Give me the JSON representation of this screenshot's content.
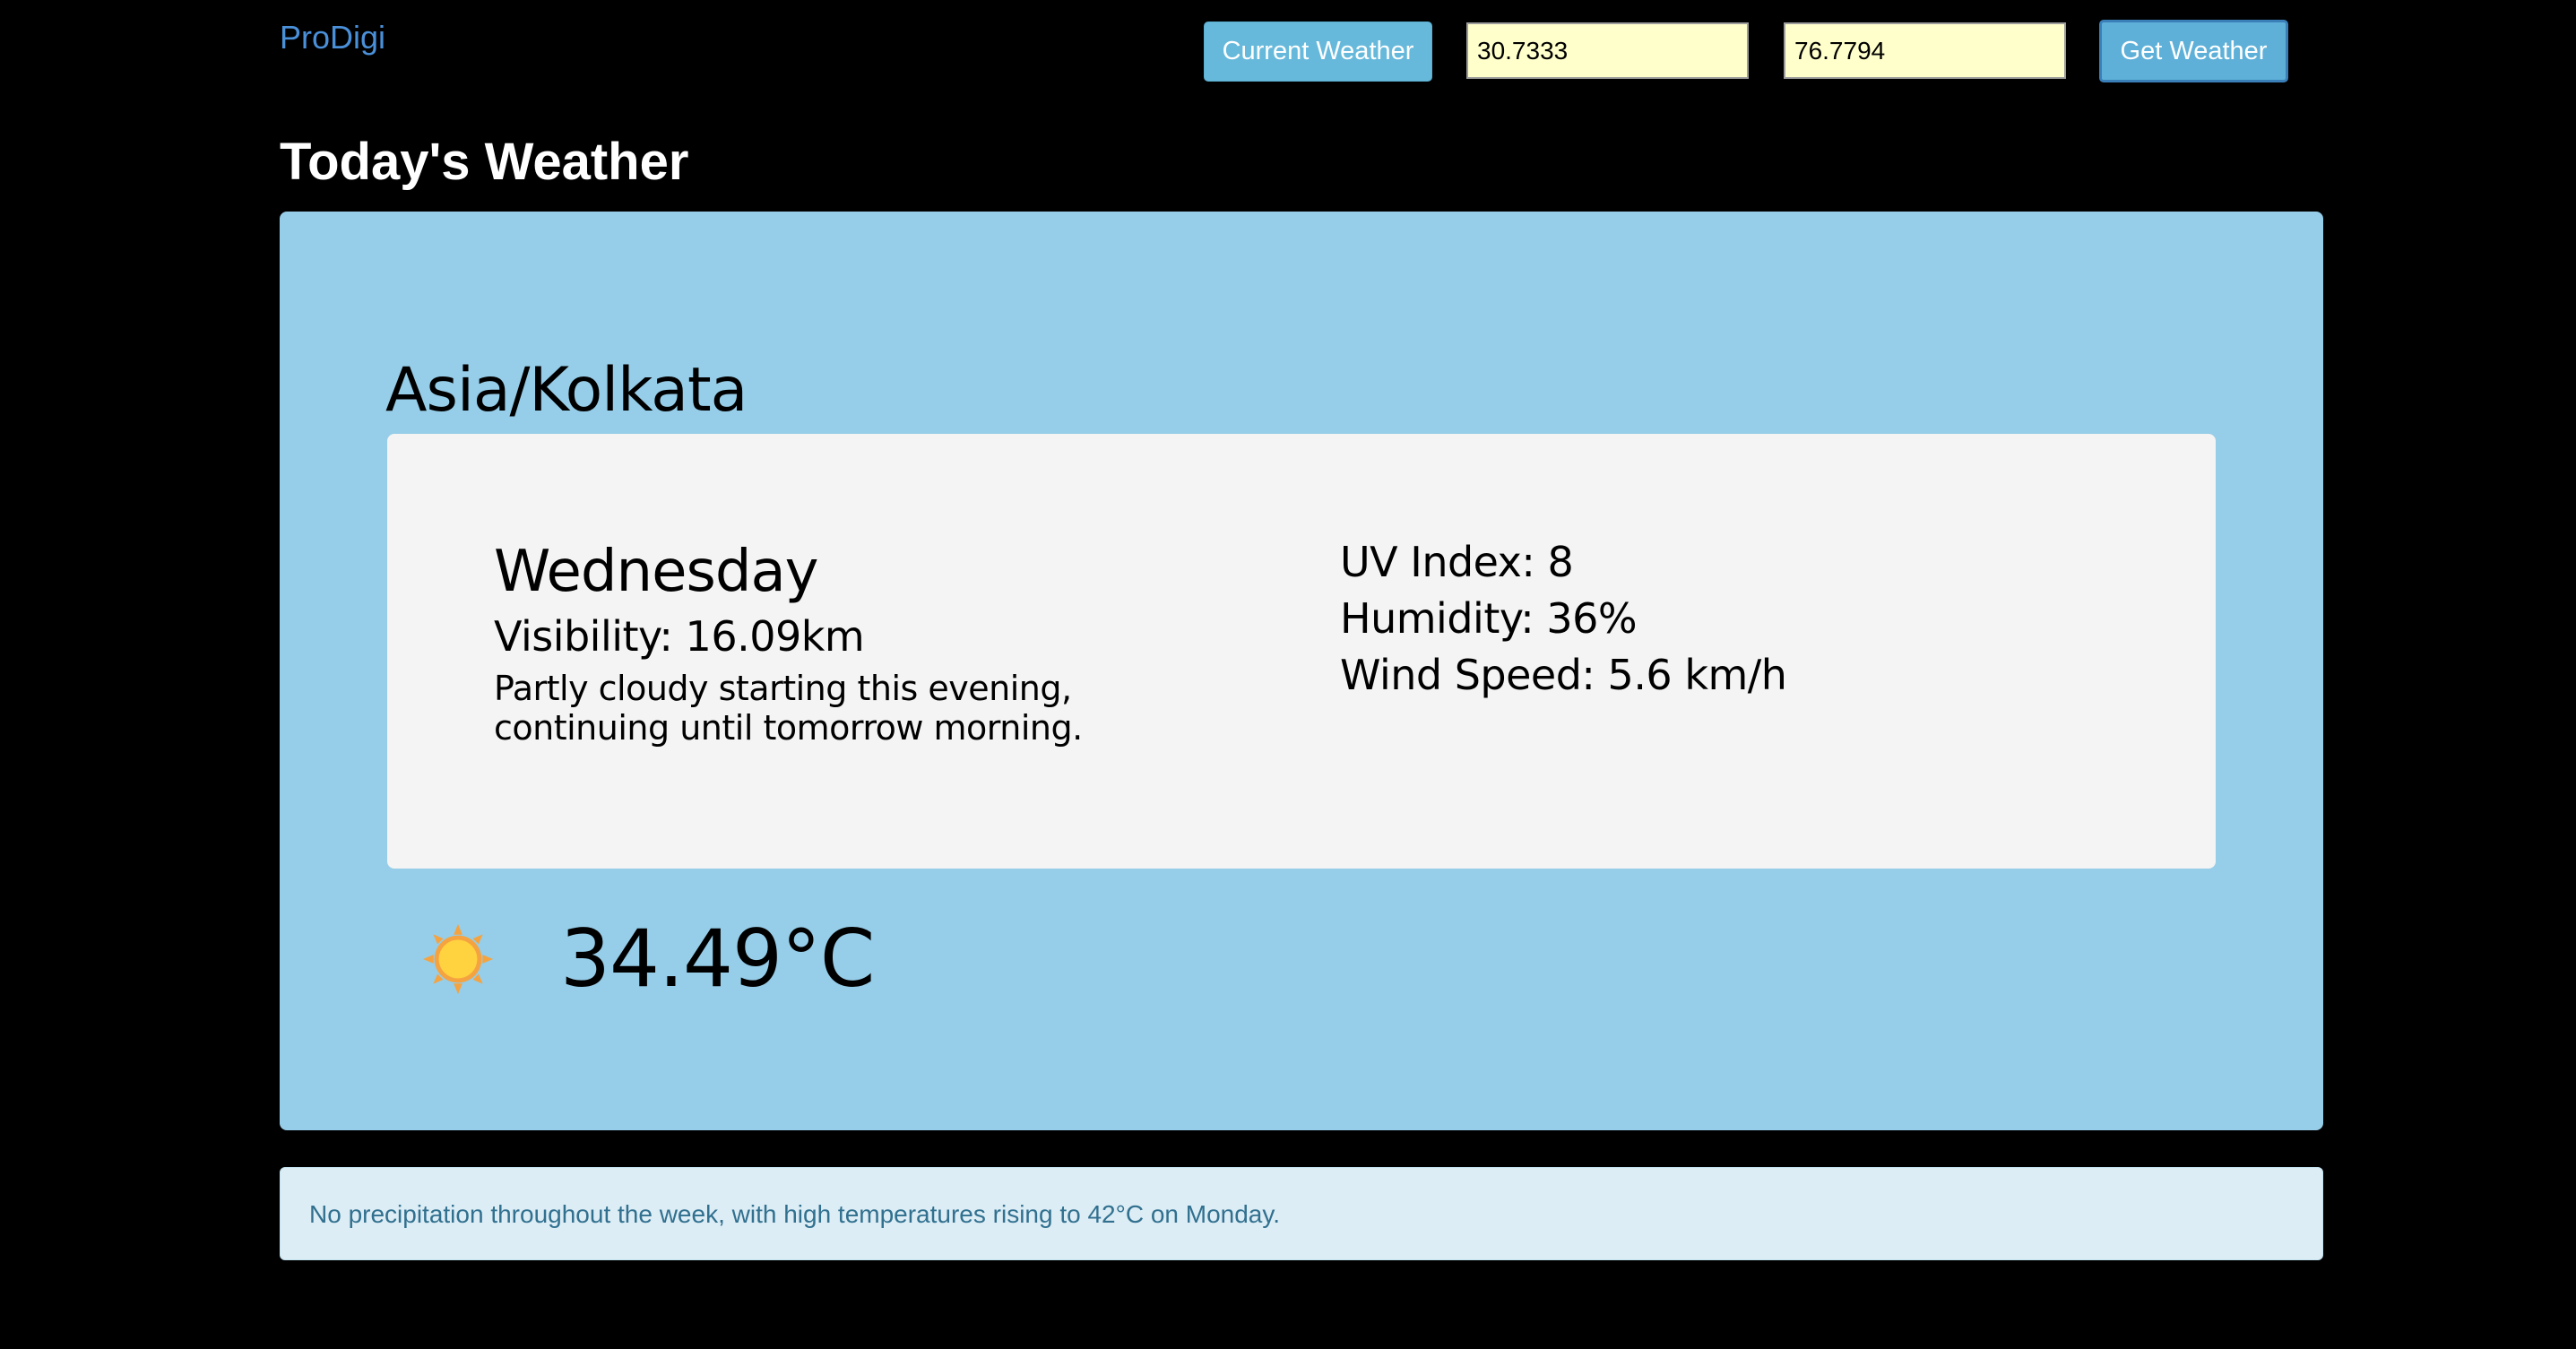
{
  "navbar": {
    "brand": "ProDigi",
    "current_weather_label": "Current Weather",
    "latitude_value": "30.7333",
    "longitude_value": "76.7794",
    "get_weather_label": "Get Weather"
  },
  "page": {
    "heading": "Today's Weather"
  },
  "weather": {
    "timezone": "Asia/Kolkata",
    "day": "Wednesday",
    "visibility": "Visibility: 16.09km",
    "summary": "Partly cloudy starting this evening, continuing until tomorrow morning.",
    "uv_index": "UV Index: 8",
    "humidity": "Humidity: 36%",
    "wind_speed": "Wind Speed: 5.6 km/h",
    "icon": "sun-icon",
    "temperature": "34.49°C"
  },
  "forecast": {
    "text": "No precipitation throughout the week, with high temperatures rising to 42°C on Monday."
  },
  "colors": {
    "background": "#000000",
    "panel": "#96cde8",
    "card": "#f4f4f4",
    "button": "#67b9db",
    "input_bg": "#ffffcc",
    "brand": "#4a90d9",
    "alert_bg": "#dcedf5",
    "alert_text": "#31708f",
    "sun": "#ffd23f",
    "sun_rays": "#f4a340"
  }
}
